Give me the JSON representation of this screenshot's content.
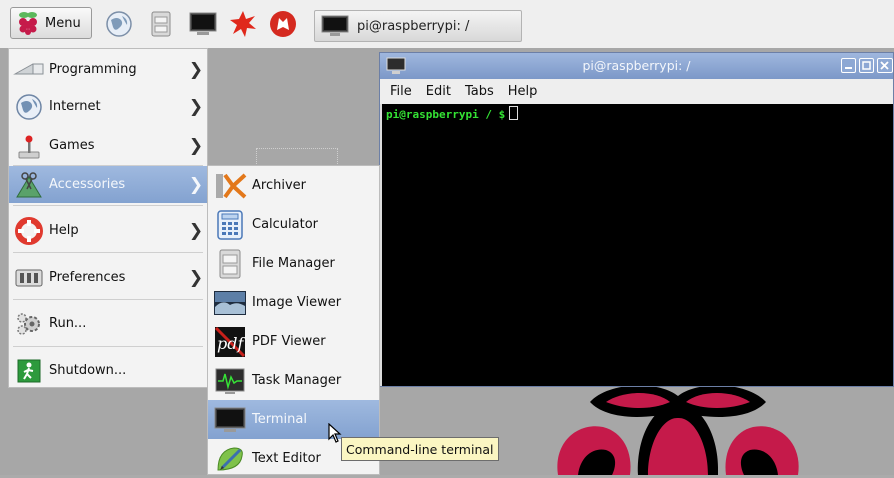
{
  "taskbar": {
    "menu_label": "Menu",
    "launchers": [
      "web-browser-icon",
      "file-manager-icon",
      "terminal-icon",
      "mathematica-icon",
      "wolfram-icon"
    ],
    "task_button_label": "pi@raspberrypi: /"
  },
  "main_menu": {
    "items": [
      {
        "label": "Programming",
        "icon": "programming-icon",
        "submenu": true
      },
      {
        "label": "Internet",
        "icon": "globe-icon",
        "submenu": true
      },
      {
        "label": "Games",
        "icon": "joystick-icon",
        "submenu": true
      },
      {
        "label": "Accessories",
        "icon": "accessories-icon",
        "submenu": true,
        "selected": true
      },
      {
        "label": "Help",
        "icon": "lifebuoy-icon",
        "submenu": true
      },
      {
        "label": "Preferences",
        "icon": "preferences-icon",
        "submenu": true
      },
      {
        "label": "Run...",
        "icon": "gears-icon",
        "submenu": false
      },
      {
        "label": "Shutdown...",
        "icon": "exit-icon",
        "submenu": false
      }
    ]
  },
  "accessories_menu": {
    "items": [
      {
        "label": "Archiver",
        "icon": "archiver-icon"
      },
      {
        "label": "Calculator",
        "icon": "calculator-icon"
      },
      {
        "label": "File Manager",
        "icon": "file-manager-icon"
      },
      {
        "label": "Image Viewer",
        "icon": "image-viewer-icon"
      },
      {
        "label": "PDF Viewer",
        "icon": "pdf-icon"
      },
      {
        "label": "Task Manager",
        "icon": "task-manager-icon"
      },
      {
        "label": "Terminal",
        "icon": "terminal-icon",
        "selected": true
      },
      {
        "label": "Text Editor",
        "icon": "text-editor-icon"
      }
    ]
  },
  "tooltip": {
    "text": "Command-line terminal"
  },
  "terminal_window": {
    "title": "pi@raspberrypi: /",
    "menus": [
      "File",
      "Edit",
      "Tabs",
      "Help"
    ],
    "prompt": "pi@raspberrypi / $"
  },
  "colors": {
    "selection": "#8ea9d4",
    "title_bar": "#8aa4d0",
    "terminal_bg": "#000000",
    "prompt_green": "#34e234",
    "tooltip_bg": "#fbf6c2",
    "raspberry": "#c51a4a"
  }
}
